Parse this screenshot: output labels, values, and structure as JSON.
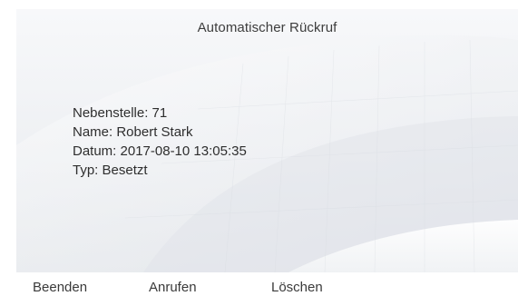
{
  "screen": {
    "title": "Automatischer Rückruf"
  },
  "details": {
    "extension": "Nebenstelle: 71",
    "name": "Name: Robert Stark",
    "date": "Datum: 2017-08-10 13:05:35",
    "type": "Typ: Besetzt"
  },
  "softkeys": {
    "end_label": "Beenden",
    "call_label": "Anrufen",
    "delete_label": "Löschen"
  },
  "colors": {
    "text": "#3a3a3a",
    "background": "#eef0f3"
  }
}
